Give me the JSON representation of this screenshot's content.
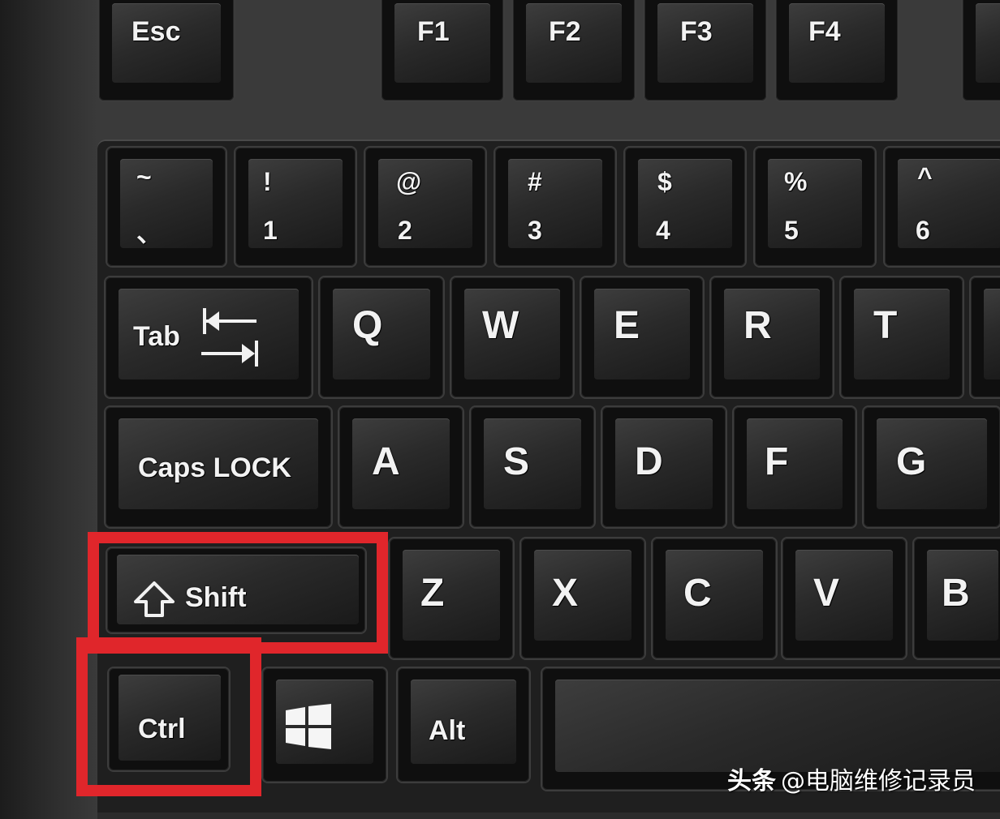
{
  "keys": {
    "esc": "Esc",
    "f1": "F1",
    "f2": "F2",
    "f3": "F3",
    "f4": "F4",
    "tilde_top": "~",
    "tilde_bottom": "、",
    "n1_top": "!",
    "n1": "1",
    "n2_top": "@",
    "n2": "2",
    "n3_top": "#",
    "n3": "3",
    "n4_top": "$",
    "n4": "4",
    "n5_top": "%",
    "n5": "5",
    "n6_top": "^",
    "n6": "6",
    "tab": "Tab",
    "q": "Q",
    "w": "W",
    "e": "E",
    "r": "R",
    "t": "T",
    "caps": "Caps LOCK",
    "a": "A",
    "s": "S",
    "d": "D",
    "f": "F",
    "g": "G",
    "shift": "Shift",
    "z": "Z",
    "x": "X",
    "c": "C",
    "v": "V",
    "b": "B",
    "ctrl": "Ctrl",
    "alt": "Alt"
  },
  "highlight_color": "#e0262b",
  "watermark": {
    "brand": "头条",
    "handle": "@电脑维修记录员"
  }
}
